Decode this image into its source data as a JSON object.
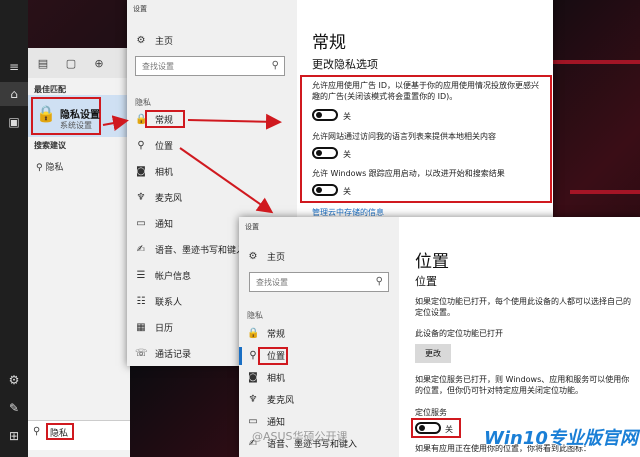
{
  "taskbar": {
    "items": [
      {
        "icon": "hamburger-icon",
        "glyph": "≡"
      },
      {
        "icon": "home-icon",
        "glyph": "⌂"
      },
      {
        "icon": "notebook-icon",
        "glyph": "▣"
      },
      {
        "icon": "settings-gear-icon",
        "glyph": "⚙"
      },
      {
        "icon": "pen-icon",
        "glyph": "✎"
      },
      {
        "icon": "windows-start-icon",
        "glyph": "⊞"
      }
    ]
  },
  "search_panel": {
    "tools": [
      "▤",
      "▢",
      "⊕"
    ],
    "best_match_header": "最佳匹配",
    "best_match_title": "隐私设置",
    "best_match_subtitle": "系统设置",
    "suggestions_header": "搜索建议",
    "suggestion": "隐私",
    "search_query": "隐私"
  },
  "win1": {
    "title": "设置",
    "home": "主页",
    "search_placeholder": "查找设置",
    "group": "隐私",
    "nav": [
      "常规",
      "位置",
      "相机",
      "麦克风",
      "通知",
      "语音、墨迹书写和键入",
      "帐户信息",
      "联系人",
      "日历",
      "通话记录"
    ],
    "nav_icons": [
      "🔒",
      "⚲",
      "◙",
      "♆",
      "▭",
      "✍",
      "☰",
      "☷",
      "▦",
      "☏"
    ],
    "heading": "常规",
    "subheading": "更改隐私选项",
    "options": [
      {
        "text": "允许应用使用广告 ID，以便基于你的应用使用情况投放你更感兴趣的广告(关闭该模式将会重置你的 ID)。",
        "state": "关"
      },
      {
        "text": "允许网站通过访问我的语言列表来提供本地相关内容",
        "state": "关"
      },
      {
        "text": "允许 Windows 跟踪应用启动，以改进开始和搜索结果",
        "state": "关"
      }
    ],
    "link": "管理云中存储的信息"
  },
  "win2": {
    "title": "设置",
    "home": "主页",
    "search_placeholder": "查找设置",
    "group": "隐私",
    "nav": [
      "常规",
      "位置",
      "相机",
      "麦克风",
      "通知",
      "语音、墨迹书写和键入"
    ],
    "heading": "位置",
    "subheading": "位置",
    "desc1": "如果定位功能已打开，每个使用此设备的人都可以选择自己的定位设置。",
    "status": "此设备的定位功能已打开",
    "change_button": "更改",
    "desc2": "如果定位服务已打开，则 Windows、应用和服务可以使用你的位置，但你仍可针对特定应用关闭定位功能。",
    "service_label": "定位服务",
    "service_state": "关",
    "desc3": "如果有应用正在使用你的位置，你将看到此图标："
  },
  "watermarks": {
    "weibo": "@ASUS华硕公开课",
    "site": "win10zyb.com",
    "brand": "Win10专业版官网"
  },
  "colors": {
    "highlight_red": "#d0191f",
    "accent_blue": "#1a6fc4"
  }
}
